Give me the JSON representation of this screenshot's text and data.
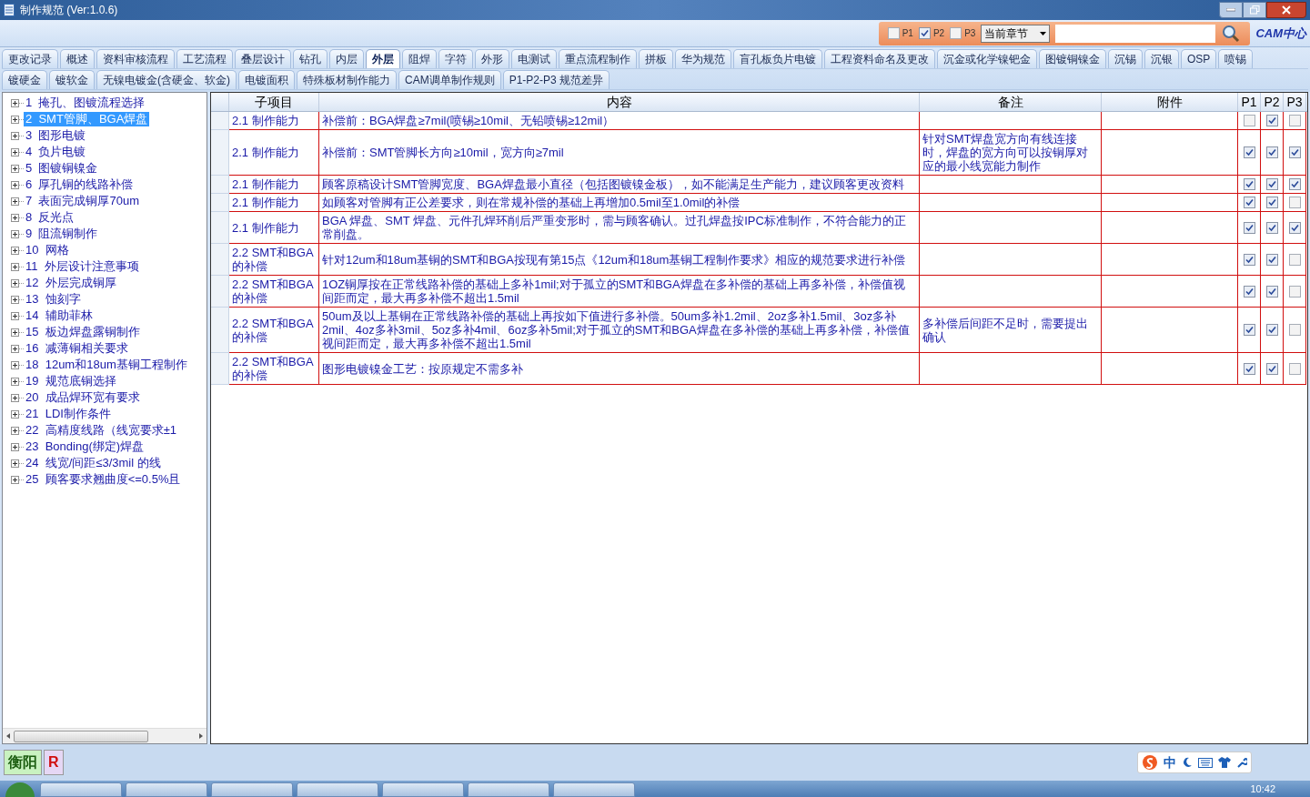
{
  "window": {
    "title": "制作规范 (Ver:1.0.6)"
  },
  "filter": {
    "options": [
      {
        "label": "P1",
        "checked": false
      },
      {
        "label": "P2",
        "checked": true
      },
      {
        "label": "P3",
        "checked": false
      }
    ],
    "scope": "当前章节",
    "logo": "CAM中心"
  },
  "tabs": [
    [
      {
        "label": "更改记录",
        "selected": false
      },
      {
        "label": "概述",
        "selected": false
      },
      {
        "label": "资料审核流程",
        "selected": false
      },
      {
        "label": "工艺流程",
        "selected": false
      },
      {
        "label": "叠层设计",
        "selected": false
      },
      {
        "label": "钻孔",
        "selected": false
      },
      {
        "label": "内层",
        "selected": false
      },
      {
        "label": "外层",
        "selected": true
      },
      {
        "label": "阻焊",
        "selected": false
      },
      {
        "label": "字符",
        "selected": false
      },
      {
        "label": "外形",
        "selected": false
      },
      {
        "label": "电测试",
        "selected": false
      },
      {
        "label": "重点流程制作",
        "selected": false
      },
      {
        "label": "拼板",
        "selected": false
      },
      {
        "label": "华为规范",
        "selected": false
      },
      {
        "label": "盲孔板负片电镀",
        "selected": false
      },
      {
        "label": "工程资料命名及更改",
        "selected": false
      },
      {
        "label": "沉金或化学镍钯金",
        "selected": false
      },
      {
        "label": "图镀铜镍金",
        "selected": false
      },
      {
        "label": "沉锡",
        "selected": false
      },
      {
        "label": "沉银",
        "selected": false
      },
      {
        "label": "OSP",
        "selected": false
      },
      {
        "label": "喷锡",
        "selected": false
      }
    ],
    [
      {
        "label": "镀硬金",
        "selected": false
      },
      {
        "label": "镀软金",
        "selected": false
      },
      {
        "label": "无镍电镀金(含硬金、软金)",
        "selected": false
      },
      {
        "label": "电镀面积",
        "selected": false
      },
      {
        "label": "特殊板材制作能力",
        "selected": false
      },
      {
        "label": "CAM调单制作规则",
        "selected": false
      },
      {
        "label": "P1-P2-P3 规范差异",
        "selected": false
      }
    ]
  ],
  "sidebar": {
    "items": [
      {
        "label": "1  掩孔、图镀流程选择",
        "selected": false
      },
      {
        "label": "2  SMT管脚、BGA焊盘",
        "selected": true
      },
      {
        "label": "3  图形电镀",
        "selected": false
      },
      {
        "label": "4  负片电镀",
        "selected": false
      },
      {
        "label": "5  图镀铜镍金",
        "selected": false
      },
      {
        "label": "6  厚孔铜的线路补偿",
        "selected": false
      },
      {
        "label": "7  表面完成铜厚70um",
        "selected": false
      },
      {
        "label": "8  反光点",
        "selected": false
      },
      {
        "label": "9  阻流铜制作",
        "selected": false
      },
      {
        "label": "10  网格",
        "selected": false
      },
      {
        "label": "11  外层设计注意事项",
        "selected": false
      },
      {
        "label": "12  外层完成铜厚",
        "selected": false
      },
      {
        "label": "13  蚀刻字",
        "selected": false
      },
      {
        "label": "14  辅助菲林",
        "selected": false
      },
      {
        "label": "15  板边焊盘露铜制作",
        "selected": false
      },
      {
        "label": "16  减薄铜相关要求",
        "selected": false
      },
      {
        "label": "18  12um和18um基铜工程制作",
        "selected": false
      },
      {
        "label": "19  规范底铜选择",
        "selected": false
      },
      {
        "label": "20  成品焊环宽有要求",
        "selected": false
      },
      {
        "label": "21  LDI制作条件",
        "selected": false
      },
      {
        "label": "22  高精度线路（线宽要求±1",
        "selected": false
      },
      {
        "label": "23  Bonding(绑定)焊盘",
        "selected": false
      },
      {
        "label": "24  线宽/间距≤3/3mil 的线",
        "selected": false
      },
      {
        "label": "25  顾客要求翘曲度<=0.5%且",
        "selected": false
      }
    ]
  },
  "table": {
    "columns": [
      "子项目",
      "内容",
      "备注",
      "附件",
      "P1",
      "P2",
      "P3"
    ],
    "rows": [
      {
        "sub": "2.1 制作能力",
        "content": "补偿前：BGA焊盘≥7mil(喷锡≥10mil、无铅喷锡≥12mil）",
        "note": "",
        "p1": false,
        "p2": true,
        "p3": false
      },
      {
        "sub": "2.1 制作能力",
        "content": "补偿前：SMT管脚长方向≥10mil，宽方向≥7mil",
        "note": "针对SMT焊盘宽方向有线连接时，焊盘的宽方向可以按铜厚对应的最小线宽能力制作",
        "p1": true,
        "p2": true,
        "p3": true
      },
      {
        "sub": "2.1 制作能力",
        "content": "顾客原稿设计SMT管脚宽度、BGA焊盘最小直径（包括图镀镍金板），如不能满足生产能力，建议顾客更改资料",
        "note": "",
        "p1": true,
        "p2": true,
        "p3": true
      },
      {
        "sub": "2.1 制作能力",
        "content": "如顾客对管脚有正公差要求，则在常规补偿的基础上再增加0.5mil至1.0mil的补偿",
        "note": "",
        "p1": true,
        "p2": true,
        "p3": false
      },
      {
        "sub": "2.1 制作能力",
        "content": "BGA 焊盘、SMT 焊盘、元件孔焊环削后严重变形时，需与顾客确认。过孔焊盘按IPC标准制作，不符合能力的正常削盘。",
        "note": "",
        "p1": true,
        "p2": true,
        "p3": true
      },
      {
        "sub": "2.2 SMT和BGA的补偿",
        "content": "针对12um和18um基铜的SMT和BGA按现有第15点《12um和18um基铜工程制作要求》相应的规范要求进行补偿",
        "note": "",
        "p1": true,
        "p2": true,
        "p3": false
      },
      {
        "sub": "2.2 SMT和BGA的补偿",
        "content": "1OZ铜厚按在正常线路补偿的基础上多补1mil;对于孤立的SMT和BGA焊盘在多补偿的基础上再多补偿，补偿值视间距而定，最大再多补偿不超出1.5mil",
        "note": "",
        "p1": true,
        "p2": true,
        "p3": false
      },
      {
        "sub": "2.2 SMT和BGA的补偿",
        "content": "50um及以上基铜在正常线路补偿的基础上再按如下值进行多补偿。50um多补1.2mil、2oz多补1.5mil、3oz多补2mil、4oz多补3mil、5oz多补4mil、6oz多补5mil;对于孤立的SMT和BGA焊盘在多补偿的基础上再多补偿，补偿值视间距而定，最大再多补偿不超出1.5mil",
        "note": "多补偿后间距不足时，需要提出确认",
        "p1": true,
        "p2": true,
        "p3": false
      },
      {
        "sub": "2.2 SMT和BGA的补偿",
        "content": "图形电镀镍金工艺：按原规定不需多补",
        "note": "",
        "p1": true,
        "p2": true,
        "p3": false
      }
    ]
  },
  "status_bar": {
    "buttons": [
      {
        "label": "衡阳",
        "kind": "city"
      },
      {
        "label": "R",
        "kind": "letter"
      }
    ]
  },
  "taskbar": {
    "ime": "中",
    "time": "10:42"
  }
}
